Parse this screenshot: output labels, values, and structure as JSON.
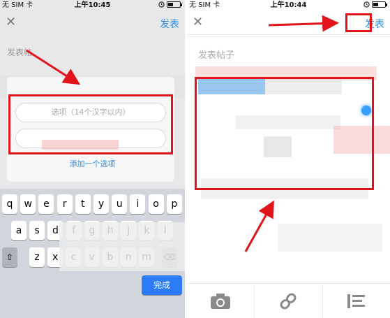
{
  "left_panel": {
    "status": {
      "carrier": "无 SIM 卡",
      "time": "上午10:45"
    },
    "nav": {
      "publish_label": "发表"
    },
    "post_label": "发表帖",
    "option_placeholder": "选项（14个汉字以内）",
    "add_option_label": "添加一个选项",
    "keyboard": {
      "row1": [
        "q",
        "w",
        "e",
        "r",
        "t",
        "y",
        "u",
        "i",
        "o",
        "p"
      ],
      "row2": [
        "a",
        "s",
        "d",
        "f",
        "g",
        "h",
        "j",
        "k",
        "l"
      ],
      "row3": [
        "z",
        "x",
        "c",
        "v",
        "b",
        "n",
        "m"
      ],
      "action_label": "完成"
    }
  },
  "right_panel": {
    "status": {
      "carrier": "无 SIM 卡",
      "time": "上午10:44"
    },
    "nav": {
      "publish_label": "发表"
    },
    "title_placeholder": "发表帖子",
    "toolbar": [
      "camera-icon",
      "link-icon",
      "format-icon"
    ]
  },
  "colors": {
    "accent": "#2b8be6",
    "annotation": "#e0141a"
  }
}
